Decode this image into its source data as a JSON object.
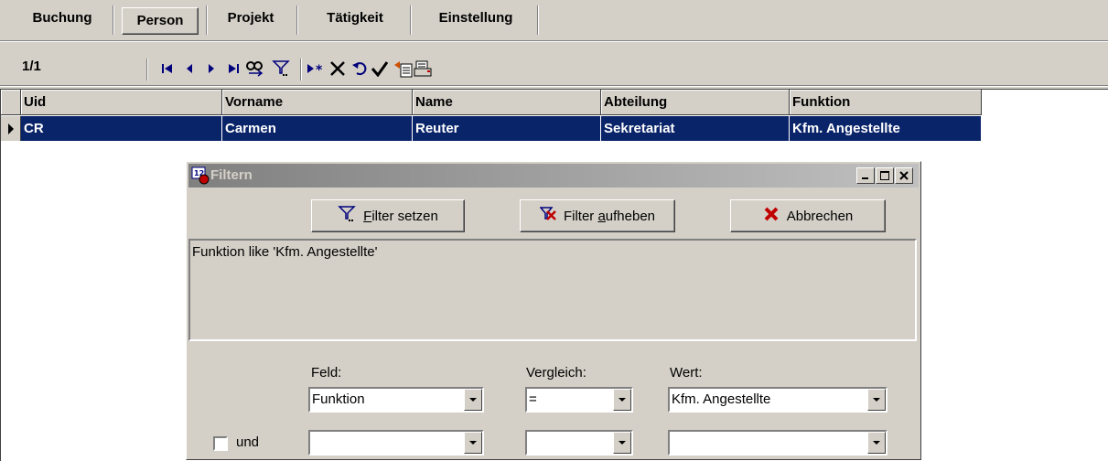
{
  "tabs": [
    {
      "label": "Buchung"
    },
    {
      "label": "Person"
    },
    {
      "label": "Projekt"
    },
    {
      "label": "Tätigkeit"
    },
    {
      "label": "Einstellung"
    }
  ],
  "record_counter": "1/1",
  "grid": {
    "columns": [
      "Uid",
      "Vorname",
      "Name",
      "Abteilung",
      "Funktion"
    ],
    "rows": [
      [
        "CR",
        "Carmen",
        "Reuter",
        "Sekretariat",
        "Kfm. Angestellte"
      ]
    ]
  },
  "dialog": {
    "title": "Filtern",
    "buttons": {
      "set_filter": {
        "mnemonic": "F",
        "rest": "ilter setzen"
      },
      "clear_filter": {
        "pre": "Filter ",
        "mnemonic": "a",
        "rest": "ufheben"
      },
      "cancel": "Abbrechen"
    },
    "filter_text": "Funktion like 'Kfm. Angestellte'",
    "labels": {
      "field": "Feld:",
      "compare": "Vergleich:",
      "value": "Wert:",
      "and": "und"
    },
    "row1": {
      "field": "Funktion",
      "compare": "=",
      "value": "Kfm. Angestellte"
    },
    "row2": {
      "field": "",
      "compare": "",
      "value": "",
      "and_checked": false
    }
  }
}
